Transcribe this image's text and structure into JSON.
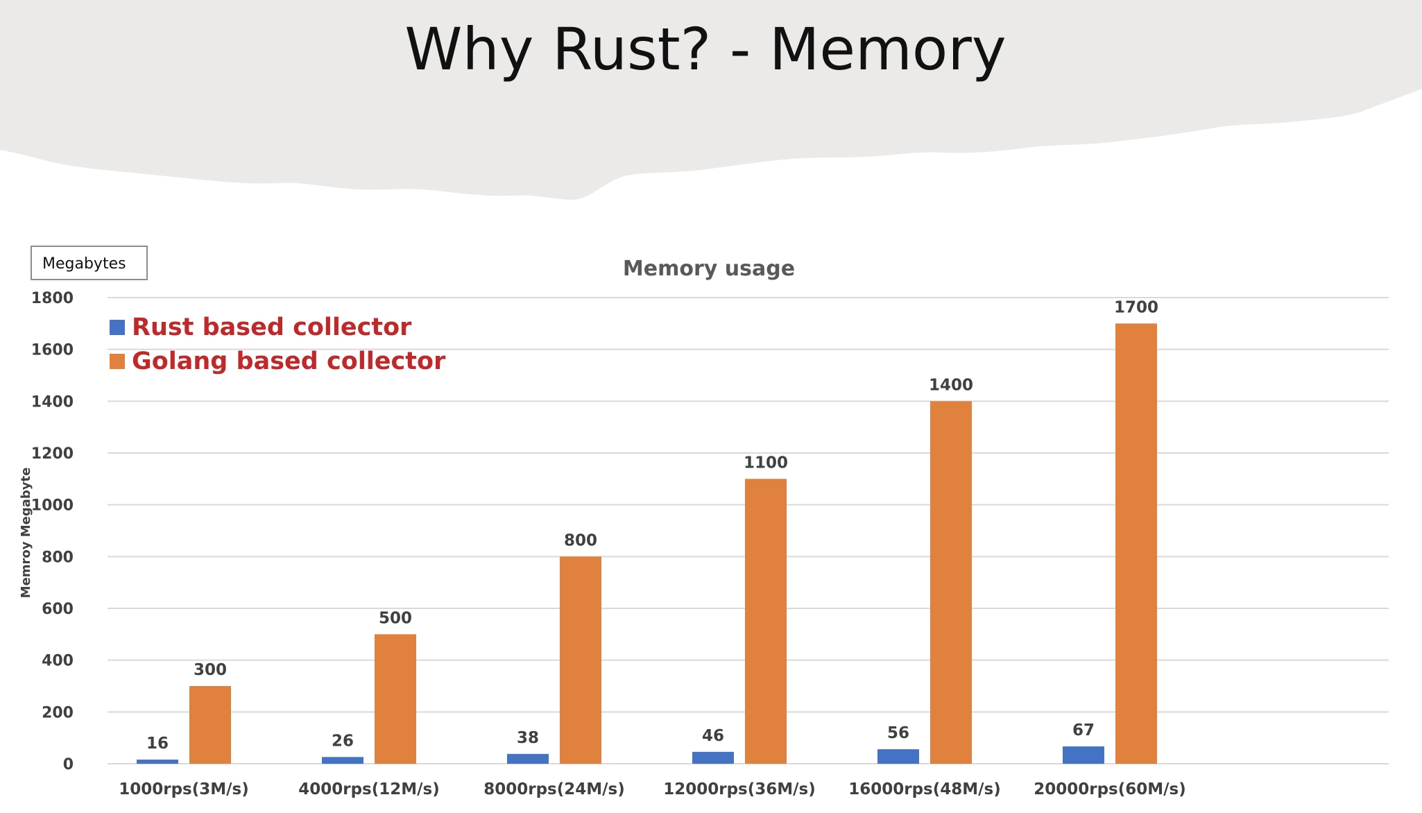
{
  "slide": {
    "title": "Why Rust? - Memory",
    "unit_box_label": "Megabytes"
  },
  "colors": {
    "rust": "#4472c4",
    "golang": "#e0813e",
    "legend_text": "#c0282a",
    "header_band": "#ebeae8",
    "gridline": "#d9d9d9"
  },
  "chart_data": {
    "type": "bar",
    "title": "Memory usage",
    "xlabel": "",
    "ylabel": "Memroy Megabyte",
    "ylim": [
      0,
      1800
    ],
    "yticks": [
      0,
      200,
      400,
      600,
      800,
      1000,
      1200,
      1400,
      1600,
      1800
    ],
    "grid": true,
    "legend_position": "top-left",
    "categories": [
      "1000rps(3M/s)",
      "4000rps(12M/s)",
      "8000rps(24M/s)",
      "12000rps(36M/s)",
      "16000rps(48M/s)",
      "20000rps(60M/s)"
    ],
    "series": [
      {
        "name": "Rust based collector",
        "values": [
          16,
          26,
          38,
          46,
          56,
          67
        ]
      },
      {
        "name": "Golang based collector",
        "values": [
          300,
          500,
          800,
          1100,
          1400,
          1700
        ]
      }
    ]
  }
}
